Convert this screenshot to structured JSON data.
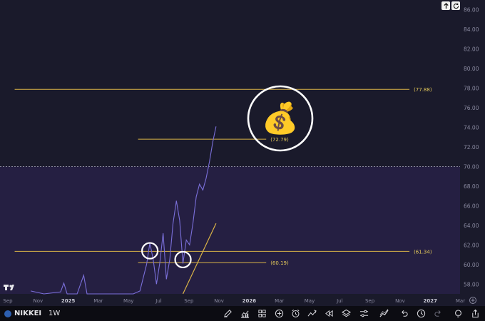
{
  "chart_data": {
    "type": "line",
    "y_axis": {
      "range": [
        57,
        87
      ],
      "ticks": [
        "86.00",
        "84.00",
        "82.00",
        "80.00",
        "78.00",
        "76.00",
        "74.00",
        "72.00",
        "70.00",
        "68.00",
        "66.00",
        "64.00",
        "62.00",
        "60.00",
        "58.00"
      ]
    },
    "x_axis": {
      "ticks": [
        {
          "label": "Sep",
          "bold": false
        },
        {
          "label": "Nov",
          "bold": false
        },
        {
          "label": "2025",
          "bold": true
        },
        {
          "label": "Mar",
          "bold": false
        },
        {
          "label": "May",
          "bold": false
        },
        {
          "label": "Jul",
          "bold": false
        },
        {
          "label": "Sep",
          "bold": false
        },
        {
          "label": "Nov",
          "bold": false
        },
        {
          "label": "2026",
          "bold": true
        },
        {
          "label": "Mar",
          "bold": false
        },
        {
          "label": "May",
          "bold": false
        },
        {
          "label": "Jul",
          "bold": false
        },
        {
          "label": "Sep",
          "bold": false
        },
        {
          "label": "Nov",
          "bold": false
        },
        {
          "label": "2027",
          "bold": true
        },
        {
          "label": "Mar",
          "bold": false
        }
      ]
    },
    "price_series": [
      [
        "2024-10-05",
        57.3
      ],
      [
        "2024-11-02",
        57.0
      ],
      [
        "2024-12-07",
        57.2
      ],
      [
        "2024-12-14",
        58.1
      ],
      [
        "2024-12-21",
        57.0
      ],
      [
        "2025-01-11",
        57.0
      ],
      [
        "2025-01-25",
        58.9
      ],
      [
        "2025-02-01",
        57.0
      ],
      [
        "2025-04-26",
        57.0
      ],
      [
        "2025-05-10",
        57.0
      ],
      [
        "2025-05-24",
        57.3
      ],
      [
        "2025-06-07",
        60.0
      ],
      [
        "2025-06-14",
        62.2
      ],
      [
        "2025-06-21",
        60.5
      ],
      [
        "2025-06-28",
        58.0
      ],
      [
        "2025-07-05",
        60.2
      ],
      [
        "2025-07-12",
        63.2
      ],
      [
        "2025-07-19",
        58.5
      ],
      [
        "2025-07-26",
        60.5
      ],
      [
        "2025-08-02",
        64.2
      ],
      [
        "2025-08-09",
        66.5
      ],
      [
        "2025-08-16",
        64.5
      ],
      [
        "2025-08-23",
        60.1
      ],
      [
        "2025-08-30",
        62.5
      ],
      [
        "2025-09-06",
        62.0
      ],
      [
        "2025-09-13",
        64.2
      ],
      [
        "2025-09-20",
        66.9
      ],
      [
        "2025-09-27",
        68.2
      ],
      [
        "2025-10-04",
        67.6
      ],
      [
        "2025-10-11",
        68.8
      ],
      [
        "2025-10-18",
        70.5
      ],
      [
        "2025-10-25",
        72.5
      ],
      [
        "2025-11-01",
        74.1
      ]
    ],
    "trend_line": [
      [
        "2025-08-23",
        57.0
      ],
      [
        "2025-11-01",
        64.2
      ]
    ],
    "levels": [
      {
        "label": "(77.88)",
        "value": 77.88,
        "x_from": "2024-09-01",
        "x_to": "2026-12-15"
      },
      {
        "label": "(72.79)",
        "value": 72.79,
        "x_from": "2025-05-20",
        "x_to": "2026-02-15"
      },
      {
        "label": "(61.34)",
        "value": 61.34,
        "x_from": "2024-09-01",
        "x_to": "2026-12-15"
      },
      {
        "label": "(60.19)",
        "value": 60.19,
        "x_from": "2025-05-20",
        "x_to": "2026-02-15"
      }
    ],
    "threshold": 70.0,
    "circles": [
      [
        "2025-06-14",
        61.4
      ],
      [
        "2025-08-23",
        60.5
      ]
    ],
    "colors": {
      "background_upper": "#1a1a2b",
      "background_lower": "#251f42",
      "price": "#7a6fd9",
      "trend": "#d9b347",
      "level": "#d9b347",
      "level_label": "#e3c85a",
      "axis_text": "#8a8aa0",
      "bar": "#0c0c12"
    }
  },
  "icons": {
    "money_bag": "💰"
  },
  "toolbar": {
    "symbol": "NIKKEI",
    "interval": "1W",
    "buttons": [
      "pencil-icon",
      "financials-icon",
      "grid-icon",
      "add-icon",
      "alarm-icon",
      "indicator-icon",
      "replay-icon",
      "layers-icon",
      "settings-icon",
      "line-style-icon",
      "undo-icon",
      "clock-icon",
      "redo-icon",
      "lightbulb-icon",
      "share-icon"
    ]
  },
  "top_controls": [
    "up-arrow-icon",
    "refresh-icon"
  ]
}
